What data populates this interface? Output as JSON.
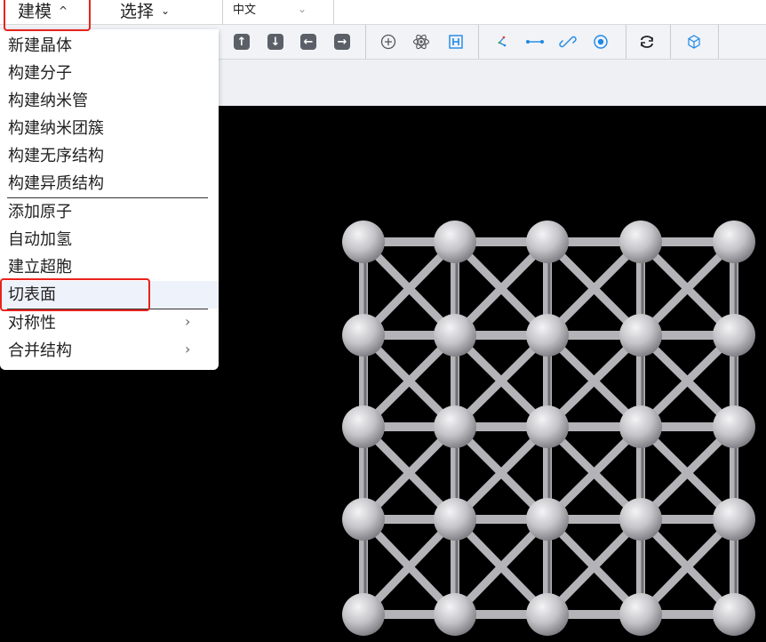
{
  "menubar": {
    "menus": [
      {
        "label": "建模",
        "state": "expanded"
      },
      {
        "label": "选择",
        "state": "collapsed"
      }
    ],
    "language": {
      "selected": "中文"
    }
  },
  "toolbar": {
    "groups": [
      {
        "name": "move",
        "icons": [
          "arrow-up-icon",
          "arrow-down-icon",
          "arrow-left-icon",
          "arrow-right-icon"
        ]
      },
      {
        "name": "atoms",
        "icons": [
          "add-atom-icon",
          "atom-icon",
          "hydrogen-icon"
        ]
      },
      {
        "name": "bonds",
        "icons": [
          "angle-icon",
          "bond-icon",
          "link-icon",
          "rotate-icon"
        ]
      },
      {
        "name": "view",
        "icons": [
          "refresh-icon"
        ]
      },
      {
        "name": "cell",
        "icons": [
          "cube-icon"
        ]
      }
    ]
  },
  "dropdown": {
    "items": [
      {
        "label": "新建晶体"
      },
      {
        "label": "构建分子"
      },
      {
        "label": "构建纳米管"
      },
      {
        "label": "构建纳米团簇"
      },
      {
        "label": "构建无序结构"
      },
      {
        "label": "构建异质结构"
      },
      {
        "label": "添加原子"
      },
      {
        "label": "自动加氢"
      },
      {
        "label": "建立超胞"
      },
      {
        "label": "切表面",
        "highlighted": true
      },
      {
        "label": "对称性",
        "has_submenu": true
      },
      {
        "label": "合并结构",
        "has_submenu": true
      }
    ],
    "submenu_arrow": "›"
  },
  "colors": {
    "highlight_box": "#e8231d",
    "viewport_background": "#000000",
    "atom": "#c8c8cc",
    "bond": "#b4b4b8"
  }
}
